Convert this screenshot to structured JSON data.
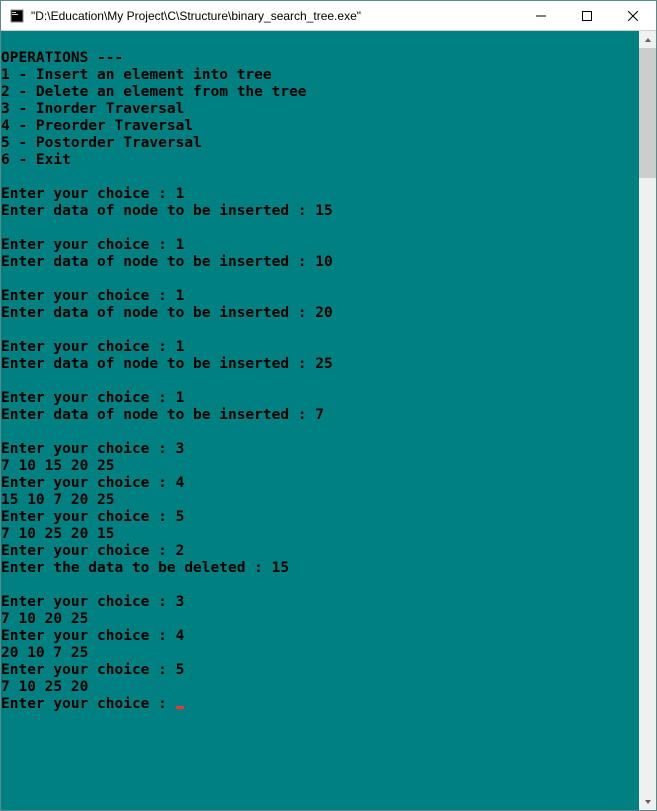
{
  "window": {
    "title": "\"D:\\Education\\My Project\\C\\Structure\\binary_search_tree.exe\""
  },
  "console": {
    "lines": [
      "",
      "OPERATIONS ---",
      "1 - Insert an element into tree",
      "2 - Delete an element from the tree",
      "3 - Inorder Traversal",
      "4 - Preorder Traversal",
      "5 - Postorder Traversal",
      "6 - Exit",
      "",
      "Enter your choice : 1",
      "Enter data of node to be inserted : 15",
      "",
      "Enter your choice : 1",
      "Enter data of node to be inserted : 10",
      "",
      "Enter your choice : 1",
      "Enter data of node to be inserted : 20",
      "",
      "Enter your choice : 1",
      "Enter data of node to be inserted : 25",
      "",
      "Enter your choice : 1",
      "Enter data of node to be inserted : 7",
      "",
      "Enter your choice : 3",
      "7 10 15 20 25",
      "Enter your choice : 4",
      "15 10 7 20 25",
      "Enter your choice : 5",
      "7 10 25 20 15",
      "Enter your choice : 2",
      "Enter the data to be deleted : 15",
      "",
      "Enter your choice : 3",
      "7 10 20 25",
      "Enter your choice : 4",
      "20 10 7 25",
      "Enter your choice : 5",
      "7 10 25 20"
    ],
    "prompt": "Enter your choice : "
  }
}
